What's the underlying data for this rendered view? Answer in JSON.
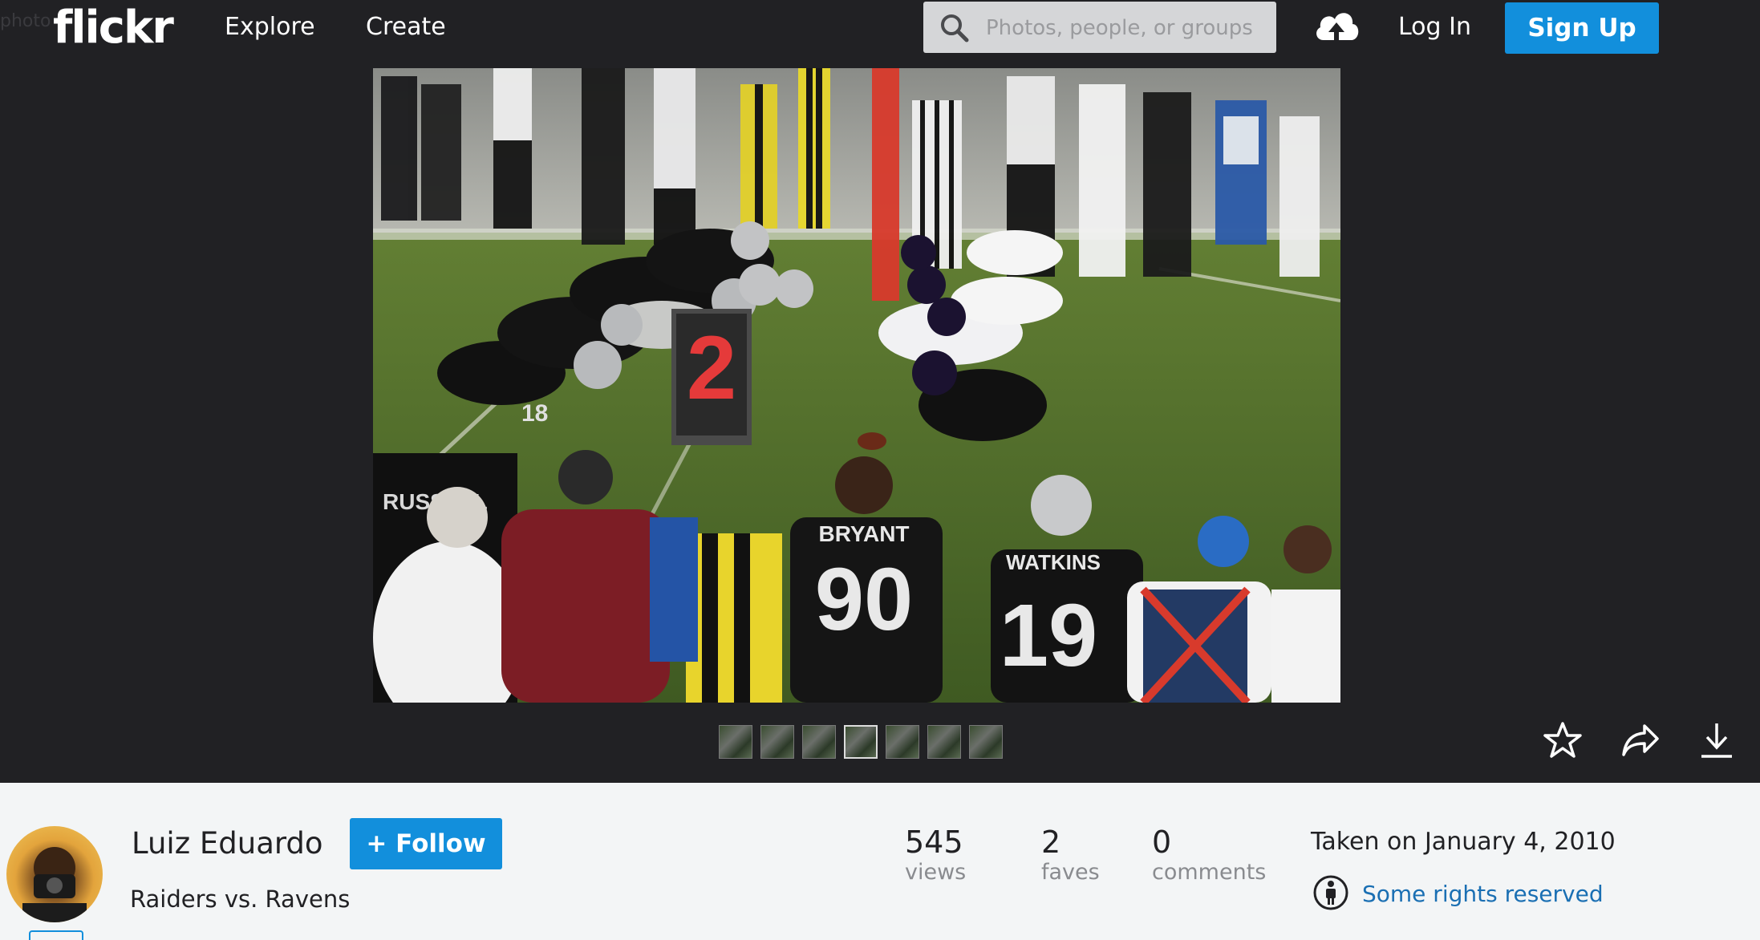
{
  "nav": {
    "ghost_text": "photo",
    "logo": "flickr",
    "explore": "Explore",
    "create": "Create",
    "search_placeholder": "Photos, people, or groups",
    "login": "Log In",
    "signup": "Sign Up"
  },
  "photo": {
    "title": "Raiders vs. Ravens",
    "author": "Luiz Eduardo",
    "follow_label": "+ Follow",
    "filmstrip_count": 7,
    "filmstrip_current_index": 3
  },
  "stats": {
    "views": {
      "value": "545",
      "label": "views"
    },
    "faves": {
      "value": "2",
      "label": "faves"
    },
    "comments": {
      "value": "0",
      "label": "comments"
    }
  },
  "meta": {
    "taken": "Taken on January 4, 2010",
    "rights": "Some rights reserved"
  },
  "scene_text": {
    "down_marker": "2",
    "jersey_bryant_name": "BRYANT",
    "jersey_bryant_number": "90",
    "jersey_watkins_name": "WATKINS",
    "jersey_watkins_number": "19",
    "jersey_russell_name": "RUSSELL",
    "jersey_back_number": "18"
  },
  "colors": {
    "topbar": "#212124",
    "accent": "#128fdc",
    "link": "#1a6fb3"
  },
  "icons": [
    "search-icon",
    "upload-cloud-icon",
    "star-icon",
    "share-icon",
    "download-icon",
    "license-person-icon"
  ]
}
